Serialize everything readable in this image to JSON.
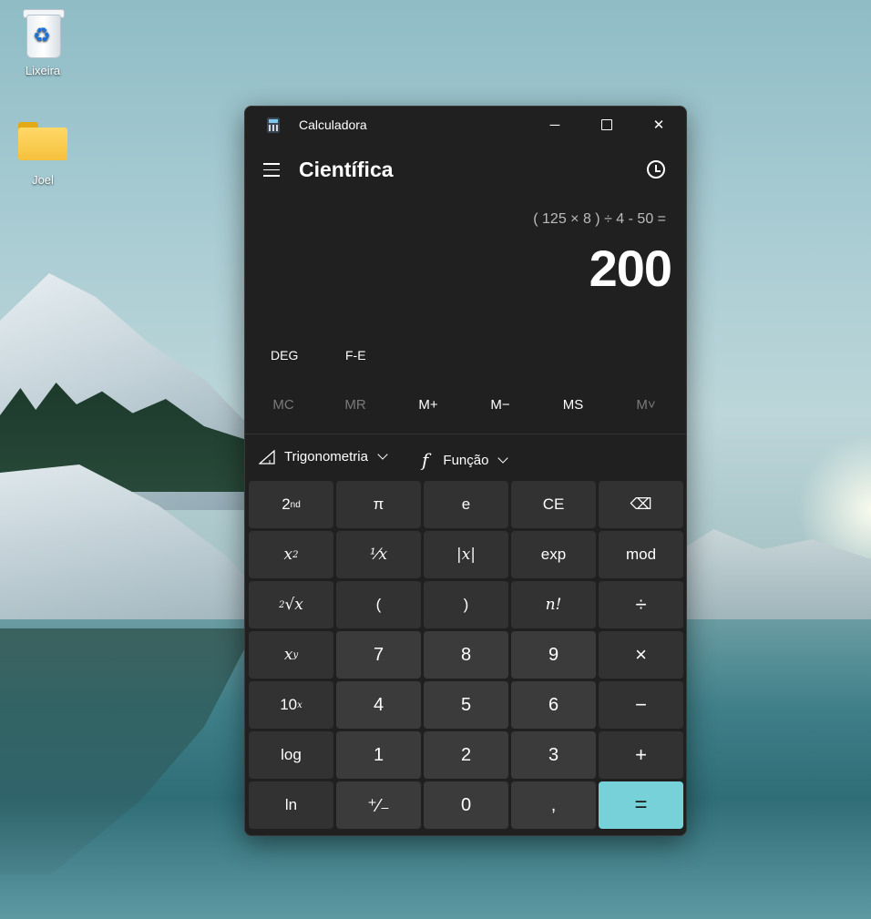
{
  "desktop": {
    "icons": [
      {
        "label": "Lixeira",
        "icon": "recycle-bin-icon"
      },
      {
        "label": "Joel",
        "icon": "folder-icon"
      }
    ]
  },
  "window": {
    "title": "Calculadora",
    "controls": {
      "minimize": "─",
      "close": "✕"
    }
  },
  "header": {
    "mode": "Científica"
  },
  "display": {
    "expression": "( 125 × 8 ) ÷ 4 - 50 =",
    "result": "200"
  },
  "angle": {
    "unit": "DEG",
    "notation": "F-E"
  },
  "memory": [
    "MC",
    "MR",
    "M+",
    "M−",
    "MS",
    "M˅"
  ],
  "functions": {
    "trig": "Trigonometria",
    "func": "Função",
    "func_symbol": "f"
  },
  "keys": {
    "second": "2",
    "second_sup": "nd",
    "pi": "π",
    "e": "e",
    "ce": "CE",
    "backspace": "⌫",
    "square": "x",
    "square_sup": "2",
    "reciprocal": "¹⁄x",
    "abs": "|x|",
    "exp": "exp",
    "mod": "mod",
    "sqrt_pre": "2",
    "sqrt": "√x",
    "lparen": "(",
    "rparen": ")",
    "factorial": "n!",
    "divide": "÷",
    "power": "x",
    "power_sup": "y",
    "seven": "7",
    "eight": "8",
    "nine": "9",
    "multiply": "×",
    "ten_pow": "10",
    "ten_pow_sup": "x",
    "four": "4",
    "five": "5",
    "six": "6",
    "minus": "−",
    "log": "log",
    "one": "1",
    "two": "2",
    "three": "3",
    "plus": "+",
    "ln": "ln",
    "negate": "⁺⁄₋",
    "zero": "0",
    "decimal": ",",
    "equals": "="
  },
  "colors": {
    "window_bg": "#202020",
    "key_bg": "#323232",
    "num_key_bg": "#3b3b3b",
    "accent": "#76d1d8"
  }
}
